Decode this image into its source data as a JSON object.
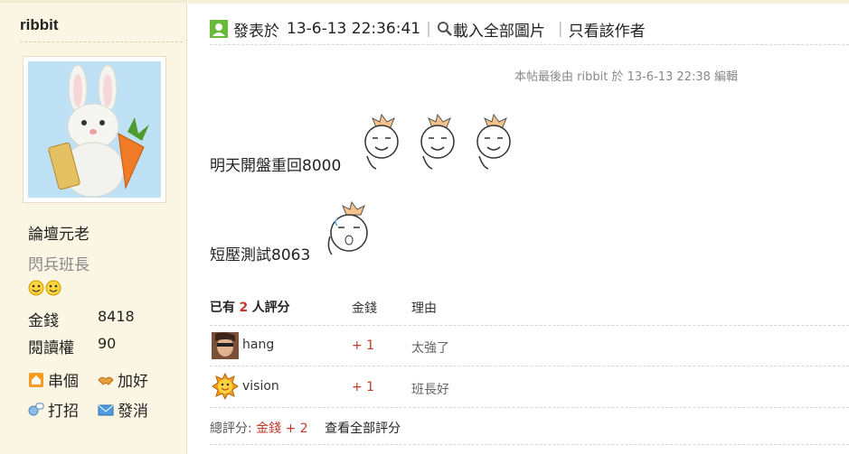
{
  "sidebar": {
    "username": "ribbit",
    "title": "論壇元老",
    "rank": "閃兵班長",
    "stats": [
      {
        "label": "金錢",
        "value": "8418"
      },
      {
        "label": "閱讀權",
        "value": "90"
      }
    ],
    "links": [
      {
        "label": "串個"
      },
      {
        "label": "加好"
      },
      {
        "label": "打招"
      },
      {
        "label": "發消"
      }
    ]
  },
  "post": {
    "posted_label": "發表於",
    "posted_time": "13-6-13 22:36:41",
    "load_images": "載入全部圖片",
    "author_only": "只看該作者",
    "edit_note": "本帖最後由 ribbit 於 13-6-13 22:38 編輯",
    "line1": "明天開盤重回8000",
    "line2": "短壓測試8063"
  },
  "rating": {
    "head_prefix": "已有",
    "head_count": "2",
    "head_suffix": "人評分",
    "col_money": "金錢",
    "col_reason": "理由",
    "rows": [
      {
        "name": "hang",
        "score": "+ 1",
        "reason": "太強了"
      },
      {
        "name": "vision",
        "score": "+ 1",
        "reason": "班長好"
      }
    ],
    "total_label": "總評分:",
    "total_value": "金錢 + 2",
    "view_all": "查看全部評分"
  },
  "colors": {
    "sidebar_bg": "#fbf6e3",
    "score_color": "#c0392b"
  }
}
